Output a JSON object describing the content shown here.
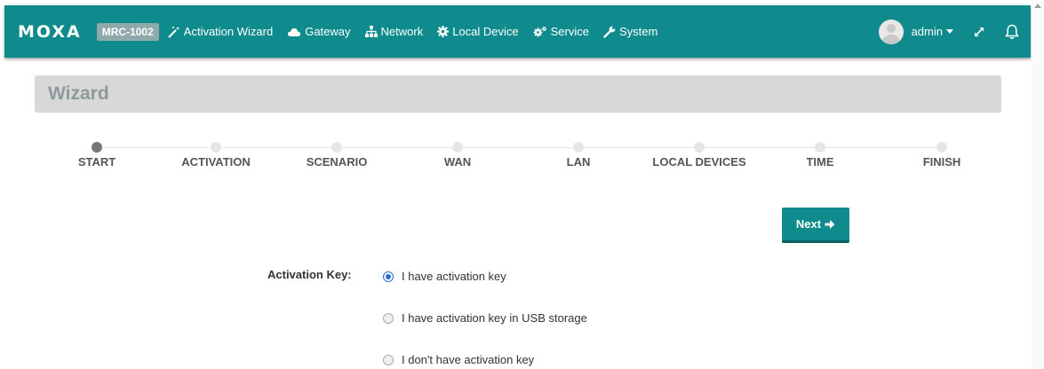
{
  "navbar": {
    "logo": "MOXA",
    "model": "MRC-1002",
    "menu": [
      {
        "label": "Activation Wizard",
        "icon": "magic-wand-icon"
      },
      {
        "label": "Gateway",
        "icon": "cloud-icon"
      },
      {
        "label": "Network",
        "icon": "sitemap-icon"
      },
      {
        "label": "Local Device",
        "icon": "cog-icon"
      },
      {
        "label": "Service",
        "icon": "cogs-icon"
      },
      {
        "label": "System",
        "icon": "wrench-icon"
      }
    ],
    "user": "admin",
    "icons": {
      "avatar": "user-avatar",
      "expand": "expand-icon",
      "notifications": "bell-icon"
    }
  },
  "wizard": {
    "title": "Wizard",
    "steps": [
      "START",
      "ACTIVATION",
      "SCENARIO",
      "WAN",
      "LAN",
      "LOCAL DEVICES",
      "TIME",
      "FINISH"
    ],
    "current_step": "START",
    "next_label": "Next"
  },
  "form": {
    "label": "Activation Key:",
    "options": [
      "I have activation key",
      "I have activation key in USB storage",
      "I don't have activation key"
    ],
    "selected_option": "I have activation key"
  },
  "colors": {
    "primary": "#0f8b8d",
    "header_bar": "#d8d8d8",
    "title_text": "#8e9a9a",
    "radio_selected": "#2c6fd1"
  }
}
